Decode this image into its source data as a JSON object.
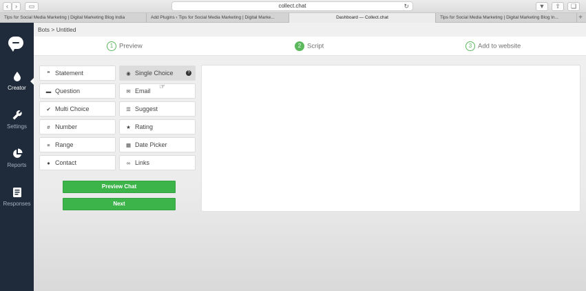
{
  "browser": {
    "url": "collect.chat",
    "tabs": [
      {
        "label": "Tips for Social Media Marketing | Digital Marketing Blog India",
        "active": false
      },
      {
        "label": "Add Plugins ‹ Tips for Social Media Marketing | Digital Marke...",
        "active": false
      },
      {
        "label": "Dashboard — Collect.chat",
        "active": true
      },
      {
        "label": "Tips for Social Media Marketing | Digital Marketing Blog In...",
        "active": false
      }
    ]
  },
  "sidebar": {
    "items": [
      {
        "label": "Creator",
        "icon": "drop-icon",
        "active": true
      },
      {
        "label": "Settings",
        "icon": "wrench-icon",
        "active": false
      },
      {
        "label": "Reports",
        "icon": "pie-chart-icon",
        "active": false
      },
      {
        "label": "Responses",
        "icon": "document-icon",
        "active": false
      }
    ]
  },
  "breadcrumb": "Bots > Untitled",
  "steps": [
    {
      "num": "1",
      "label": "Preview",
      "active": false
    },
    {
      "num": "2",
      "label": "Script",
      "active": true
    },
    {
      "num": "3",
      "label": "Add to website",
      "active": false
    }
  ],
  "questions": [
    {
      "label": "Statement",
      "icon": "statement-icon",
      "glyph": "❞"
    },
    {
      "label": "Single Choice",
      "icon": "radio-icon",
      "glyph": "◉",
      "selected": true,
      "help": "?"
    },
    {
      "label": "Question",
      "icon": "chat-icon",
      "glyph": "▬"
    },
    {
      "label": "Email",
      "icon": "envelope-icon",
      "glyph": "✉"
    },
    {
      "label": "Multi Choice",
      "icon": "check-circle-icon",
      "glyph": "✔"
    },
    {
      "label": "Suggest",
      "icon": "list-icon",
      "glyph": "☰"
    },
    {
      "label": "Number",
      "icon": "hash-icon",
      "glyph": "#"
    },
    {
      "label": "Rating",
      "icon": "star-icon",
      "glyph": "★"
    },
    {
      "label": "Range",
      "icon": "range-icon",
      "glyph": "≡"
    },
    {
      "label": "Date Picker",
      "icon": "calendar-icon",
      "glyph": "▦"
    },
    {
      "label": "Contact",
      "icon": "contact-icon",
      "glyph": "●"
    },
    {
      "label": "Links",
      "icon": "link-icon",
      "glyph": "∞"
    }
  ],
  "actions": {
    "preview_label": "Preview Chat",
    "next_label": "Next"
  },
  "colors": {
    "sidebar": "#1f2b3a",
    "accent_green": "#3cb44a"
  }
}
